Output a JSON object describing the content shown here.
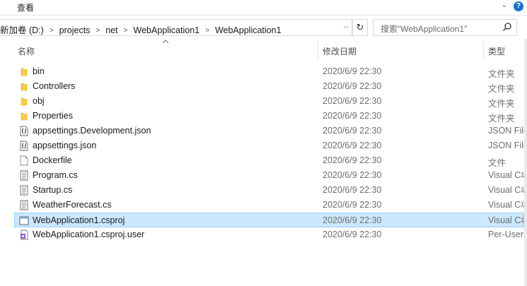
{
  "ribbon": {
    "view_tab": "查看"
  },
  "address": {
    "crumbs": [
      "新加卷 (D:)",
      "projects",
      "net",
      "WebApplication1",
      "WebApplication1"
    ]
  },
  "search": {
    "placeholder": "搜索\"WebApplication1\""
  },
  "columns": {
    "name": "名称",
    "modified": "修改日期",
    "type": "类型"
  },
  "files": [
    {
      "name": "bin",
      "modified": "2020/6/9 22:30",
      "type": "文件夹",
      "icon": "folder-icon"
    },
    {
      "name": "Controllers",
      "modified": "2020/6/9 22:30",
      "type": "文件夹",
      "icon": "folder-icon"
    },
    {
      "name": "obj",
      "modified": "2020/6/9 22:30",
      "type": "文件夹",
      "icon": "folder-icon"
    },
    {
      "name": "Properties",
      "modified": "2020/6/9 22:30",
      "type": "文件夹",
      "icon": "folder-icon"
    },
    {
      "name": "appsettings.Development.json",
      "modified": "2020/6/9 22:30",
      "type": "JSON File",
      "icon": "json-file-icon"
    },
    {
      "name": "appsettings.json",
      "modified": "2020/6/9 22:30",
      "type": "JSON File",
      "icon": "json-file-icon"
    },
    {
      "name": "Dockerfile",
      "modified": "2020/6/9 22:30",
      "type": "文件",
      "icon": "blank-file-icon"
    },
    {
      "name": "Program.cs",
      "modified": "2020/6/9 22:30",
      "type": "Visual C#",
      "icon": "text-file-icon"
    },
    {
      "name": "Startup.cs",
      "modified": "2020/6/9 22:30",
      "type": "Visual C#",
      "icon": "text-file-icon"
    },
    {
      "name": "WeatherForecast.cs",
      "modified": "2020/6/9 22:30",
      "type": "Visual C#",
      "icon": "text-file-icon"
    },
    {
      "name": "WebApplication1.csproj",
      "modified": "2020/6/9 22:30",
      "type": "Visual C#",
      "icon": "window-file-icon",
      "selected": true
    },
    {
      "name": "WebApplication1.csproj.user",
      "modified": "2020/6/9 22:30",
      "type": "Per-User",
      "icon": "vs-user-file-icon"
    }
  ],
  "colors": {
    "selection": "#cce8ff",
    "selection_border": "#99d1ff",
    "folder": "#f8cc4a"
  }
}
